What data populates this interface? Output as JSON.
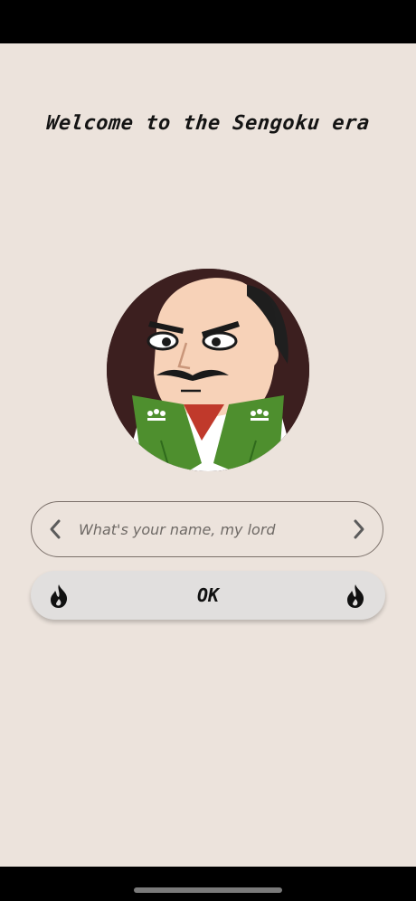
{
  "screen": {
    "title": "Welcome to the Sengoku era",
    "avatar_description": "samurai-lord-portrait"
  },
  "name_field": {
    "placeholder": "What's your name, my lord",
    "value": "",
    "prev_icon": "chevron-left-icon",
    "next_icon": "chevron-right-icon"
  },
  "ok_button": {
    "label": "OK",
    "left_icon": "flame-icon",
    "right_icon": "flame-icon"
  },
  "colors": {
    "background": "#ece3dc",
    "button_bg": "#e1dfde",
    "field_border": "#7a6f69",
    "text": "#141414",
    "robe_green": "#4e8f2e"
  }
}
